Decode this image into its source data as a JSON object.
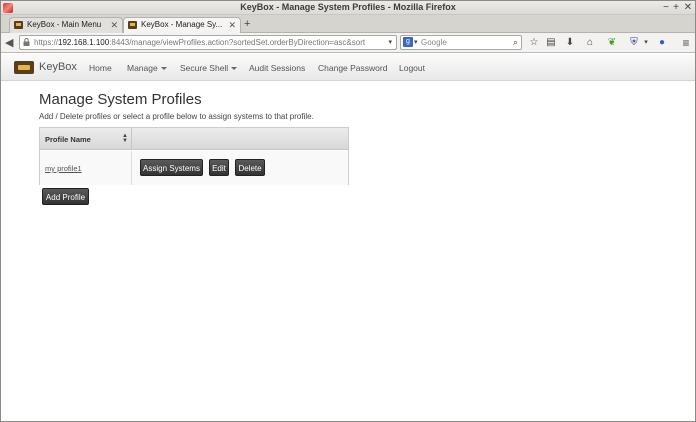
{
  "window": {
    "title": "KeyBox - Manage System Profiles - Mozilla Firefox",
    "controls": {
      "minimize": "−",
      "maximize": "+",
      "close": "✕"
    }
  },
  "tabs": [
    {
      "label": "KeyBox - Main Menu",
      "close": "✕"
    },
    {
      "label": "KeyBox - Manage Sy...",
      "close": "✕"
    }
  ],
  "new_tab": "+",
  "url": {
    "scheme": "https://",
    "host": "192.168.1.100",
    "rest": ":8443/manage/viewProfiles.action?sortedSet.orderByDirection=asc&sort",
    "dropdown": "▾"
  },
  "search": {
    "placeholder": "Google",
    "engine": "g",
    "engine_drop": "▾"
  },
  "app": {
    "brand": "KeyBox",
    "nav": {
      "home": "Home",
      "manage": "Manage",
      "secure_shell": "Secure Shell",
      "audit": "Audit Sessions",
      "change_password": "Change Password",
      "logout": "Logout"
    }
  },
  "main": {
    "title": "Manage System Profiles",
    "description": "Add / Delete profiles or select a profile below to assign systems to that profile.",
    "table": {
      "headers": [
        "Profile Name",
        ""
      ],
      "rows": [
        {
          "name": "my profile1",
          "actions": [
            "Assign Systems",
            "Edit",
            "Delete"
          ]
        }
      ]
    },
    "add_button": "Add Profile"
  },
  "colors": {
    "accent_brown": "#5a3d1a",
    "accent_gold": "#e4b64a",
    "button_dark": "#333333"
  }
}
